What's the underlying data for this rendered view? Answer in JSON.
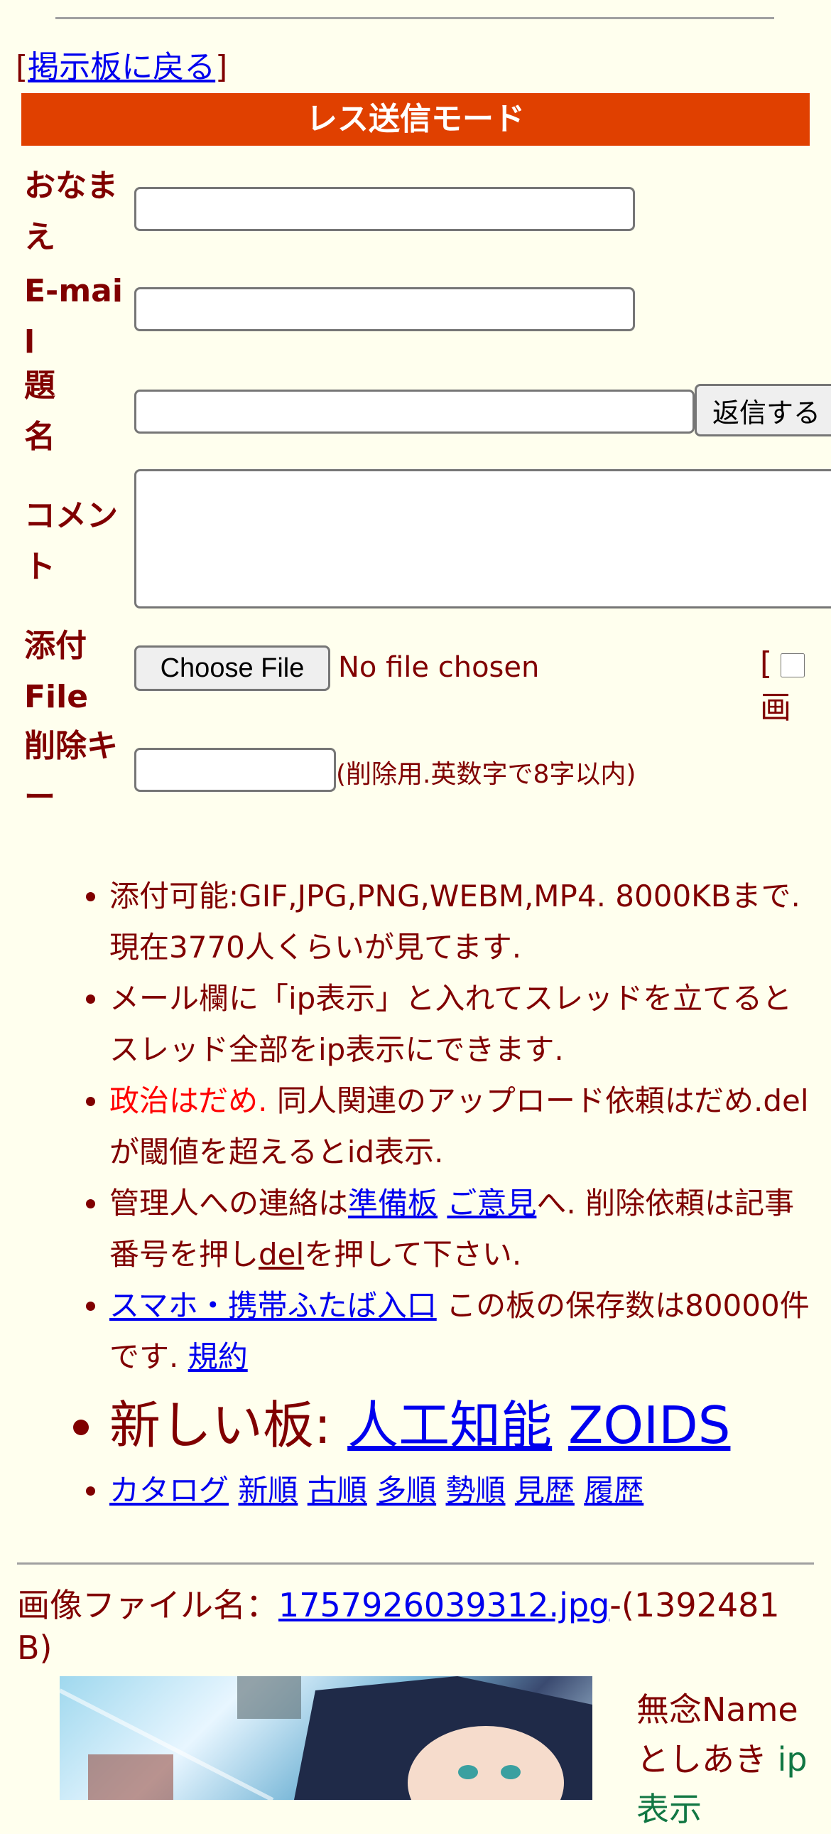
{
  "nav": {
    "back_link": "掲示板に戻る",
    "open_bracket": "[",
    "close_bracket": "]"
  },
  "mode_title": "レス送信モード",
  "form": {
    "name_label": "おなまえ",
    "email_label": "E-mail",
    "subject_label": "題名",
    "submit_label": "返信する",
    "comment_label": "コメント",
    "file_label": "添付File",
    "choose_file_label": "Choose File",
    "no_file_text": "No file chosen",
    "image_checkbox_prefix": "[",
    "image_checkbox_label": "画",
    "delkey_label": "削除キー",
    "delkey_note": "(削除用.英数字で8字以内)"
  },
  "info": {
    "line1": "添付可能:GIF,JPG,PNG,WEBM,MP4. 8000KBまで. 現在3770人くらいが見てます.",
    "line2": "メール欄に「ip表示」と入れてスレッドを立てるとスレッド全部をip表示にできます.",
    "line3_red": "政治はだめ.",
    "line3_rest": " 同人関連のアップロード依頼はだめ.delが閾値を超えるとid表示.",
    "line4_pre": "管理人への連絡は",
    "line4_link1": "準備板",
    "line4_link2": "ご意見",
    "line4_mid": "へ. 削除依頼は記事番号を押し",
    "line4_link3": "del",
    "line4_post": "を押して下さい.",
    "line5_link": "スマホ・携帯ふたば入口",
    "line5_text": " この板の保存数は80000件です. ",
    "line5_link2": "規約",
    "line6_prefix": "新しい板: ",
    "line6_link1": "人工知能",
    "line6_link2": "ZOIDS",
    "nav_links": [
      "カタログ",
      "新順",
      "古順",
      "多順",
      "勢順",
      "見歴",
      "履歴"
    ]
  },
  "post": {
    "file_prefix": "画像ファイル名：",
    "file_name": "1757926039312.jpg",
    "file_size": "-(1392481 B)",
    "name": "無念Name",
    "sub": "としあき",
    "ip": "ip",
    "ip_cont": "表示"
  }
}
